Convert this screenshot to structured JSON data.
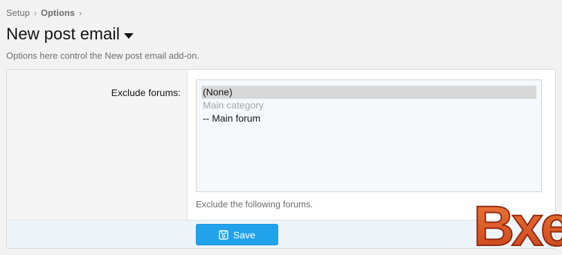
{
  "breadcrumb": {
    "items": [
      "Setup",
      "Options"
    ]
  },
  "page": {
    "title": "New post email",
    "description": "Options here control the New post email add-on."
  },
  "form": {
    "field_label": "Exclude forums:",
    "options": [
      {
        "label": "(None)",
        "state": "selected"
      },
      {
        "label": "Main category",
        "state": "disabled"
      },
      {
        "label": "-- Main forum",
        "state": "normal"
      }
    ],
    "hint": "Exclude the following forums.",
    "save_label": "Save"
  },
  "watermark": {
    "text": "Bxen"
  },
  "colors": {
    "accent": "#21a3ec",
    "footer_bg": "#edf4fa",
    "watermark_fill": "#e8541a"
  }
}
